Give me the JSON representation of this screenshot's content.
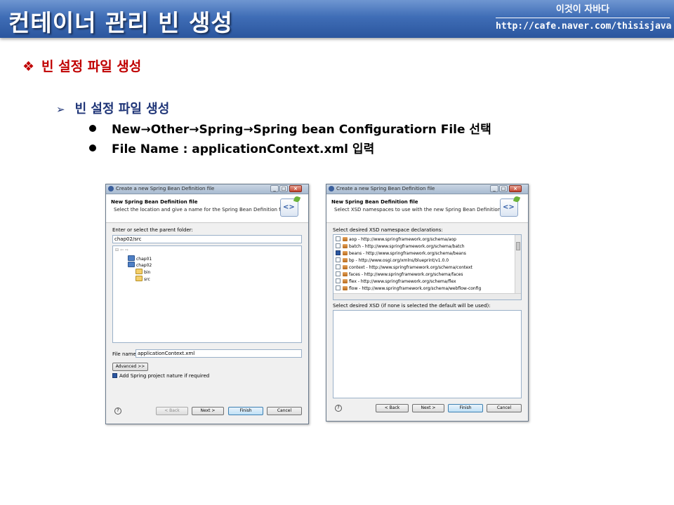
{
  "header": {
    "title": "컨테이너 관리 빈 생성",
    "cafe_name": "이것이 자바다",
    "url": "http://cafe.naver.com/thisisjava"
  },
  "slide": {
    "section_bullet": "❖",
    "section_title": "빈 설정 파일 생성",
    "sub_bullet": "➢",
    "sub_title": "빈 설정 파일 생성",
    "bullets": [
      "New→Other→Spring→Spring bean Configuratiorn File 선택",
      "File Name : applicationContext.xml 입력"
    ]
  },
  "dialog1": {
    "window_title": "Create a new Spring Bean Definition file",
    "banner_title": "New Spring Bean Definition file",
    "banner_desc": "Select the location and give a name for the Spring Bean Definition file",
    "folder_label": "Enter or select the parent folder:",
    "folder_value": "chap02/src",
    "tree": [
      "chap01",
      "chap02",
      "bin",
      "src"
    ],
    "file_name_label": "File name:",
    "file_name_value": "applicationContext.xml",
    "advanced_label": "Advanced >>",
    "nature_label": "Add Spring project nature if required",
    "nature_checked": true,
    "back_label": "< Back",
    "next_label": "Next >",
    "finish_label": "Finish",
    "cancel_label": "Cancel"
  },
  "dialog2": {
    "window_title": "Create a new Spring Bean Definition file",
    "banner_title": "New Spring Bean Definition file",
    "banner_desc": "Select XSD namespaces to use with the new Spring Bean Definition",
    "ns_label": "Select desired XSD namespace declarations:",
    "namespaces": [
      {
        "text": "aop - http://www.springframework.org/schema/aop",
        "checked": false
      },
      {
        "text": "batch - http://www.springframework.org/schema/batch",
        "checked": false
      },
      {
        "text": "beans - http://www.springframework.org/schema/beans",
        "checked": true
      },
      {
        "text": "bp - http://www.osgi.org/xmlns/blueprint/v1.0.0",
        "checked": false
      },
      {
        "text": "context - http://www.springframework.org/schema/context",
        "checked": false
      },
      {
        "text": "faces - http://www.springframework.org/schema/faces",
        "checked": false
      },
      {
        "text": "flex - http://www.springframework.org/schema/flex",
        "checked": false
      },
      {
        "text": "flow - http://www.springframework.org/schema/webflow-config",
        "checked": false
      }
    ],
    "xsd_label": "Select desired XSD (if none is selected the default will be used):",
    "back_label": "< Back",
    "next_label": "Next >",
    "finish_label": "Finish",
    "cancel_label": "Cancel"
  },
  "colors": {
    "header_blue": "#3f6db6",
    "section_red": "#c00000",
    "sub_navy": "#1f3577"
  }
}
